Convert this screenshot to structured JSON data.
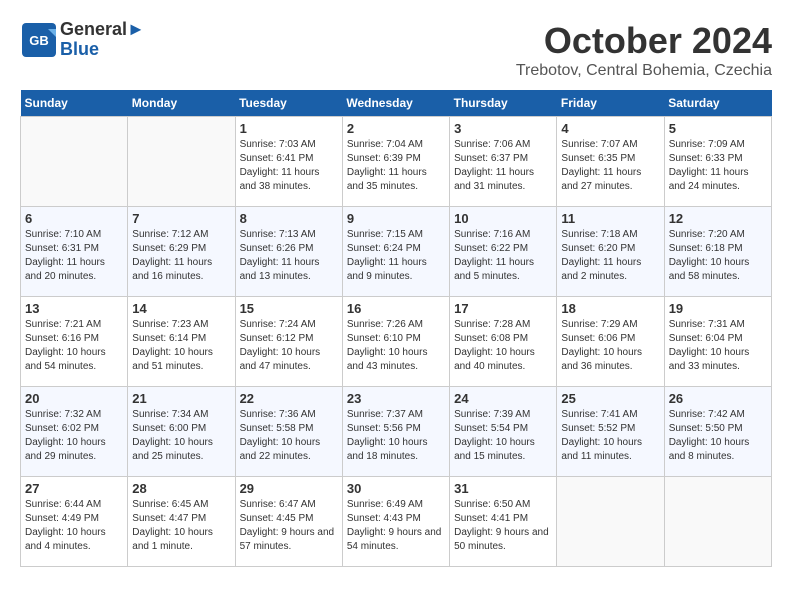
{
  "header": {
    "logo_line1": "General",
    "logo_line2": "Blue",
    "month": "October 2024",
    "location": "Trebotov, Central Bohemia, Czechia"
  },
  "weekdays": [
    "Sunday",
    "Monday",
    "Tuesday",
    "Wednesday",
    "Thursday",
    "Friday",
    "Saturday"
  ],
  "weeks": [
    [
      {
        "day": "",
        "info": ""
      },
      {
        "day": "",
        "info": ""
      },
      {
        "day": "1",
        "info": "Sunrise: 7:03 AM\nSunset: 6:41 PM\nDaylight: 11 hours and 38 minutes."
      },
      {
        "day": "2",
        "info": "Sunrise: 7:04 AM\nSunset: 6:39 PM\nDaylight: 11 hours and 35 minutes."
      },
      {
        "day": "3",
        "info": "Sunrise: 7:06 AM\nSunset: 6:37 PM\nDaylight: 11 hours and 31 minutes."
      },
      {
        "day": "4",
        "info": "Sunrise: 7:07 AM\nSunset: 6:35 PM\nDaylight: 11 hours and 27 minutes."
      },
      {
        "day": "5",
        "info": "Sunrise: 7:09 AM\nSunset: 6:33 PM\nDaylight: 11 hours and 24 minutes."
      }
    ],
    [
      {
        "day": "6",
        "info": "Sunrise: 7:10 AM\nSunset: 6:31 PM\nDaylight: 11 hours and 20 minutes."
      },
      {
        "day": "7",
        "info": "Sunrise: 7:12 AM\nSunset: 6:29 PM\nDaylight: 11 hours and 16 minutes."
      },
      {
        "day": "8",
        "info": "Sunrise: 7:13 AM\nSunset: 6:26 PM\nDaylight: 11 hours and 13 minutes."
      },
      {
        "day": "9",
        "info": "Sunrise: 7:15 AM\nSunset: 6:24 PM\nDaylight: 11 hours and 9 minutes."
      },
      {
        "day": "10",
        "info": "Sunrise: 7:16 AM\nSunset: 6:22 PM\nDaylight: 11 hours and 5 minutes."
      },
      {
        "day": "11",
        "info": "Sunrise: 7:18 AM\nSunset: 6:20 PM\nDaylight: 11 hours and 2 minutes."
      },
      {
        "day": "12",
        "info": "Sunrise: 7:20 AM\nSunset: 6:18 PM\nDaylight: 10 hours and 58 minutes."
      }
    ],
    [
      {
        "day": "13",
        "info": "Sunrise: 7:21 AM\nSunset: 6:16 PM\nDaylight: 10 hours and 54 minutes."
      },
      {
        "day": "14",
        "info": "Sunrise: 7:23 AM\nSunset: 6:14 PM\nDaylight: 10 hours and 51 minutes."
      },
      {
        "day": "15",
        "info": "Sunrise: 7:24 AM\nSunset: 6:12 PM\nDaylight: 10 hours and 47 minutes."
      },
      {
        "day": "16",
        "info": "Sunrise: 7:26 AM\nSunset: 6:10 PM\nDaylight: 10 hours and 43 minutes."
      },
      {
        "day": "17",
        "info": "Sunrise: 7:28 AM\nSunset: 6:08 PM\nDaylight: 10 hours and 40 minutes."
      },
      {
        "day": "18",
        "info": "Sunrise: 7:29 AM\nSunset: 6:06 PM\nDaylight: 10 hours and 36 minutes."
      },
      {
        "day": "19",
        "info": "Sunrise: 7:31 AM\nSunset: 6:04 PM\nDaylight: 10 hours and 33 minutes."
      }
    ],
    [
      {
        "day": "20",
        "info": "Sunrise: 7:32 AM\nSunset: 6:02 PM\nDaylight: 10 hours and 29 minutes."
      },
      {
        "day": "21",
        "info": "Sunrise: 7:34 AM\nSunset: 6:00 PM\nDaylight: 10 hours and 25 minutes."
      },
      {
        "day": "22",
        "info": "Sunrise: 7:36 AM\nSunset: 5:58 PM\nDaylight: 10 hours and 22 minutes."
      },
      {
        "day": "23",
        "info": "Sunrise: 7:37 AM\nSunset: 5:56 PM\nDaylight: 10 hours and 18 minutes."
      },
      {
        "day": "24",
        "info": "Sunrise: 7:39 AM\nSunset: 5:54 PM\nDaylight: 10 hours and 15 minutes."
      },
      {
        "day": "25",
        "info": "Sunrise: 7:41 AM\nSunset: 5:52 PM\nDaylight: 10 hours and 11 minutes."
      },
      {
        "day": "26",
        "info": "Sunrise: 7:42 AM\nSunset: 5:50 PM\nDaylight: 10 hours and 8 minutes."
      }
    ],
    [
      {
        "day": "27",
        "info": "Sunrise: 6:44 AM\nSunset: 4:49 PM\nDaylight: 10 hours and 4 minutes."
      },
      {
        "day": "28",
        "info": "Sunrise: 6:45 AM\nSunset: 4:47 PM\nDaylight: 10 hours and 1 minute."
      },
      {
        "day": "29",
        "info": "Sunrise: 6:47 AM\nSunset: 4:45 PM\nDaylight: 9 hours and 57 minutes."
      },
      {
        "day": "30",
        "info": "Sunrise: 6:49 AM\nSunset: 4:43 PM\nDaylight: 9 hours and 54 minutes."
      },
      {
        "day": "31",
        "info": "Sunrise: 6:50 AM\nSunset: 4:41 PM\nDaylight: 9 hours and 50 minutes."
      },
      {
        "day": "",
        "info": ""
      },
      {
        "day": "",
        "info": ""
      }
    ]
  ]
}
